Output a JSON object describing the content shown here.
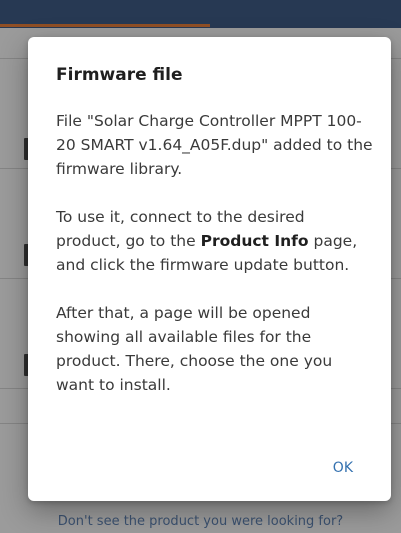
{
  "background": {
    "footer_link": "Don't see the product you were looking for?"
  },
  "dialog": {
    "title": "Firmware file",
    "paragraph1": "File \"Solar Charge Controller MPPT 100-20 SMART v1.64_A05F.dup\" added to the firmware library.",
    "paragraph2_before": "To use it, connect to the desired product, go to the ",
    "paragraph2_bold": "Product Info",
    "paragraph2_after": " page, and click the firmware update button.",
    "paragraph3": "After that, a page will be opened showing all available files for the product. There, choose the one you want to install.",
    "ok_label": "OK"
  },
  "colors": {
    "header": "#3e5a82",
    "tab_indicator": "#e27c3a",
    "accent": "#3572b0"
  }
}
